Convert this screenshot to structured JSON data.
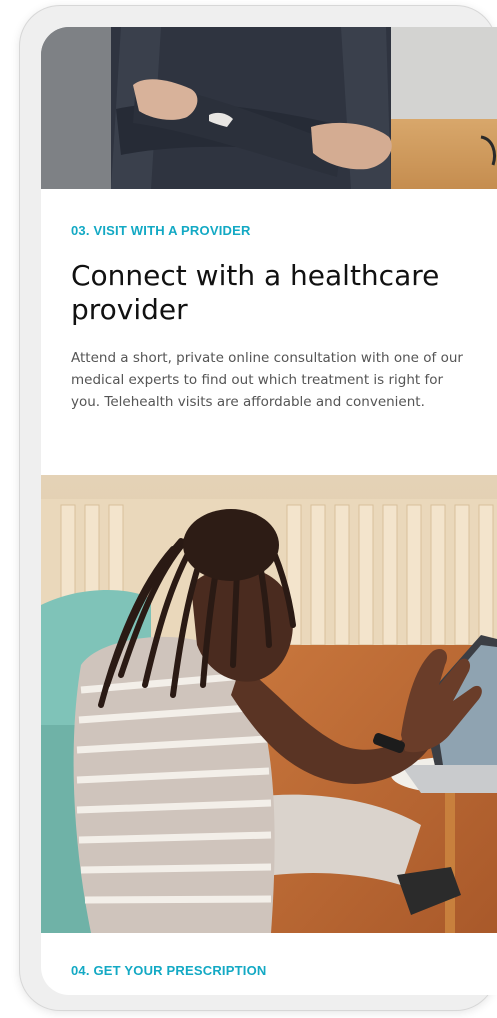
{
  "step3": {
    "label": "03. VISIT WITH A PROVIDER",
    "heading": "Connect with a healthcare provider",
    "body": "Attend a short, private online consultation with one of our medical experts to find out which treatment is right for you. Telehealth visits are affordable and convenient."
  },
  "step4": {
    "label": "04. GET YOUR PRESCRIPTION"
  },
  "photos": {
    "top": "person-arms-crossed-photo",
    "bottom": "woman-video-call-laptop-photo"
  },
  "colors": {
    "accent": "#13a9c4",
    "heading": "#111111",
    "body": "#555555"
  }
}
